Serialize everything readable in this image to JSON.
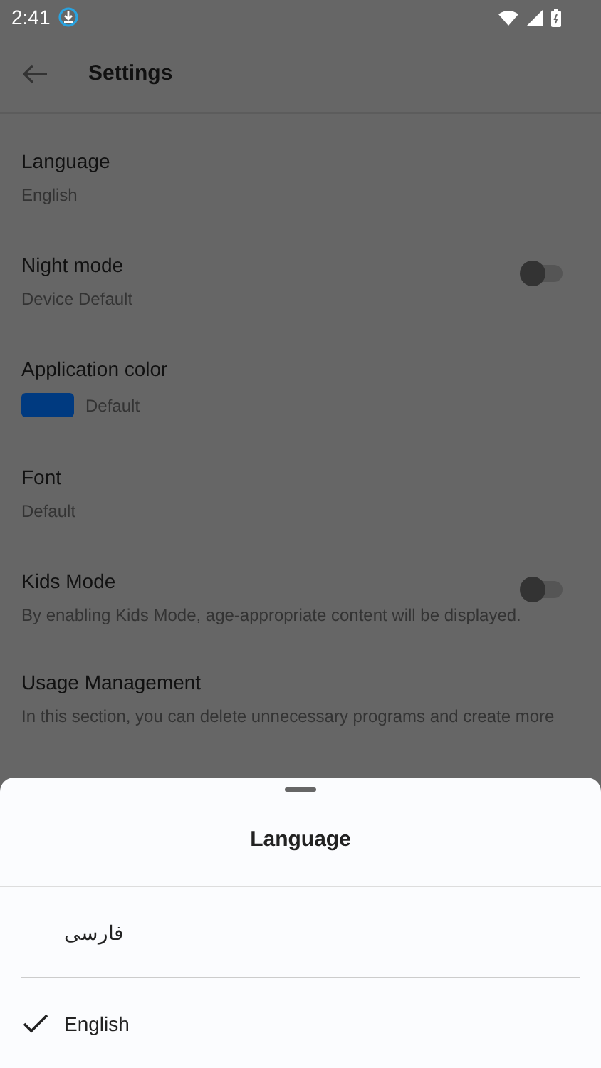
{
  "status_bar": {
    "time": "2:41"
  },
  "header": {
    "title": "Settings"
  },
  "settings": [
    {
      "kind": "value",
      "title": "Language",
      "value": "English"
    },
    {
      "kind": "toggle",
      "title": "Night mode",
      "value": "Device Default",
      "on": false
    },
    {
      "kind": "color",
      "title": "Application color",
      "value": "Default",
      "color": "#003a80"
    },
    {
      "kind": "value",
      "title": "Font",
      "value": "Default"
    },
    {
      "kind": "toggle",
      "title": "Kids Mode",
      "description": "By enabling Kids Mode, age-appropriate content will be displayed.",
      "on": false
    },
    {
      "kind": "value",
      "title": "Usage Management",
      "description": "In this section, you can delete unnecessary programs and create more"
    }
  ],
  "sheet": {
    "title": "Language",
    "options": [
      {
        "label": "فارسی",
        "selected": false
      },
      {
        "label": "English",
        "selected": true
      }
    ]
  }
}
